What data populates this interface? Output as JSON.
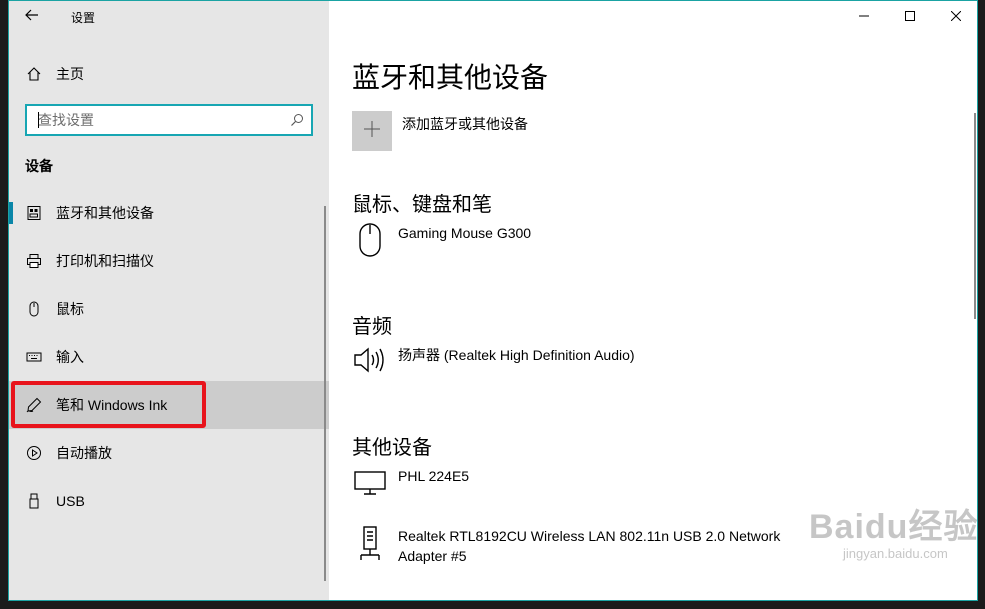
{
  "app": {
    "title": "设置"
  },
  "sidebar": {
    "home_label": "主页",
    "search_placeholder": "查找设置",
    "section_title": "设备",
    "items": [
      {
        "label": "蓝牙和其他设备",
        "icon": "bluetooth-devices-icon",
        "state": "selected"
      },
      {
        "label": "打印机和扫描仪",
        "icon": "printer-icon",
        "state": "normal"
      },
      {
        "label": "鼠标",
        "icon": "mouse-icon",
        "state": "normal"
      },
      {
        "label": "输入",
        "icon": "keyboard-icon",
        "state": "normal"
      },
      {
        "label": "笔和 Windows Ink",
        "icon": "pen-icon",
        "state": "hovered"
      },
      {
        "label": "自动播放",
        "icon": "autoplay-icon",
        "state": "normal"
      },
      {
        "label": "USB",
        "icon": "usb-icon",
        "state": "normal"
      }
    ]
  },
  "main": {
    "title": "蓝牙和其他设备",
    "add_device_label": "添加蓝牙或其他设备",
    "groups": [
      {
        "title": "鼠标、键盘和笔",
        "devices": [
          {
            "name": "Gaming Mouse G300",
            "icon": "mouse-icon"
          }
        ]
      },
      {
        "title": "音频",
        "devices": [
          {
            "name": "扬声器 (Realtek High Definition Audio)",
            "icon": "speaker-icon"
          }
        ]
      },
      {
        "title": "其他设备",
        "devices": [
          {
            "name": "PHL 224E5",
            "icon": "monitor-icon"
          },
          {
            "name": "Realtek RTL8192CU Wireless LAN 802.11n USB 2.0 Network Adapter #5",
            "icon": "network-adapter-icon"
          }
        ]
      }
    ]
  },
  "watermark": {
    "line1": "Baidu经验",
    "line2": "jingyan.baidu.com"
  },
  "colors": {
    "accent": "#0a86a8",
    "search_border": "#17a6b3",
    "highlight_box": "#e8131b",
    "sidebar_bg": "#e6e6e6",
    "hover_bg": "#cccccc"
  }
}
